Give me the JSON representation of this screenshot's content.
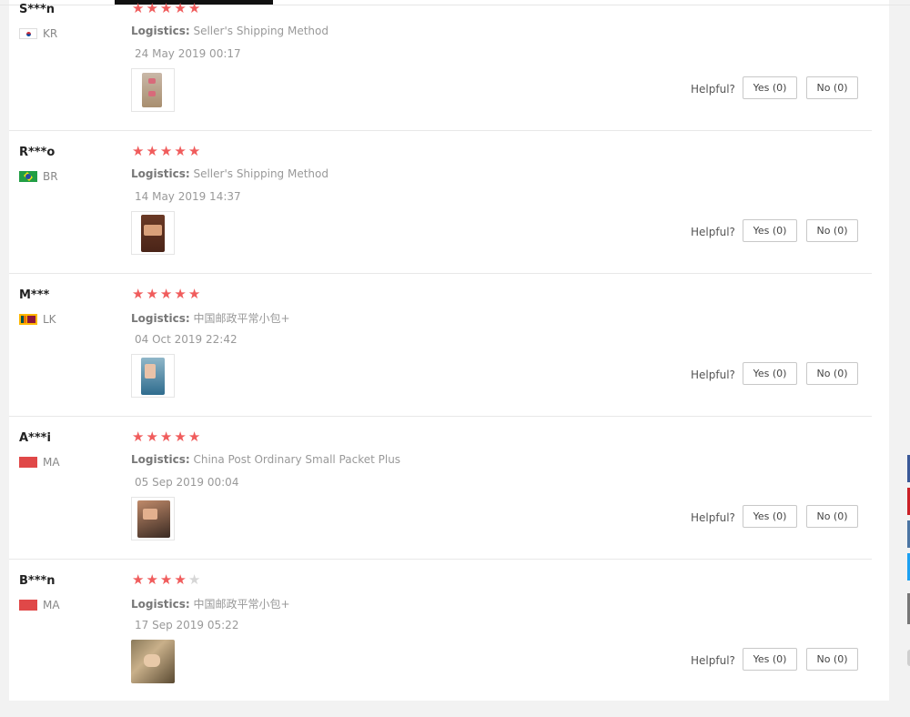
{
  "helpful_label": "Helpful?",
  "reviews": [
    {
      "user": "S***n",
      "country_code": "KR",
      "stars": 5,
      "logistics_label": "Logistics:",
      "logistics": "Seller's Shipping Method",
      "date": "24 May 2019 00:17",
      "yes_label": "Yes (0)",
      "no_label": "No (0)"
    },
    {
      "user": "R***o",
      "country_code": "BR",
      "stars": 5,
      "logistics_label": "Logistics:",
      "logistics": "Seller's Shipping Method",
      "date": "14 May 2019 14:37",
      "yes_label": "Yes (0)",
      "no_label": "No (0)"
    },
    {
      "user": "M***",
      "country_code": "LK",
      "stars": 5,
      "logistics_label": "Logistics:",
      "logistics": "中国邮政平常小包+",
      "date": "04 Oct 2019 22:42",
      "yes_label": "Yes (0)",
      "no_label": "No (0)"
    },
    {
      "user": "A***i",
      "country_code": "MA",
      "stars": 5,
      "logistics_label": "Logistics:",
      "logistics": "China Post Ordinary Small Packet Plus",
      "date": "05 Sep 2019 00:04",
      "yes_label": "Yes (0)",
      "no_label": "No (0)"
    },
    {
      "user": "B***n",
      "country_code": "MA",
      "stars": 4,
      "logistics_label": "Logistics:",
      "logistics": "中国邮政平常小包+",
      "date": "17 Sep 2019 05:22",
      "yes_label": "Yes (0)",
      "no_label": "No (0)"
    }
  ],
  "colors": {
    "star_on": "#f05c5c",
    "star_off": "#d6d6d6",
    "share_facebook": "#3b5998",
    "share_pinterest": "#cb2027",
    "share_vk": "#4c75a3",
    "share_twitter": "#1da1f2",
    "share_other": "#777777"
  }
}
